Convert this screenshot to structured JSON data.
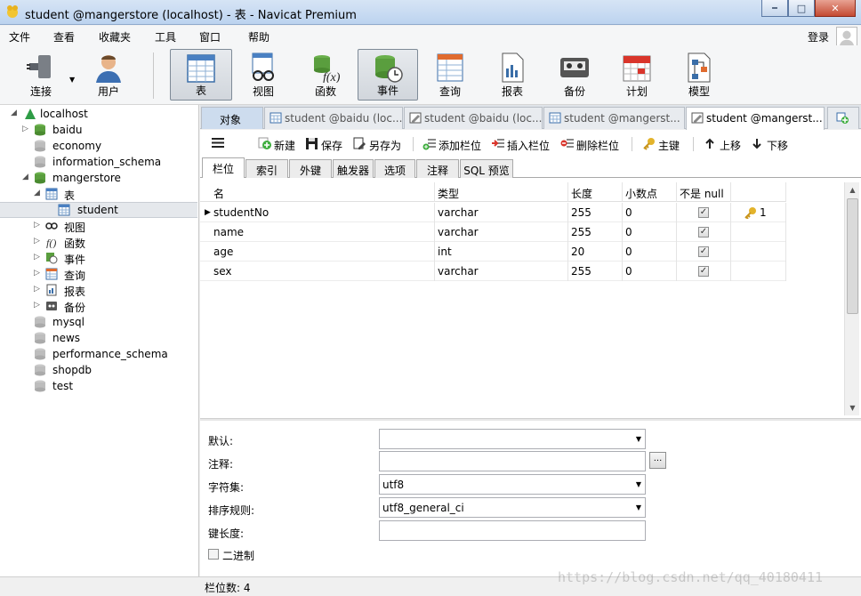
{
  "window": {
    "title": "student @mangerstore (localhost) - 表 - Navicat Premium"
  },
  "menu": {
    "items": [
      "文件",
      "查看",
      "收藏夹",
      "工具",
      "窗口",
      "帮助"
    ],
    "login": "登录"
  },
  "toolbar": {
    "buttons": [
      "连接",
      "用户",
      "表",
      "视图",
      "函数",
      "事件",
      "查询",
      "报表",
      "备份",
      "计划",
      "模型"
    ],
    "active": "表"
  },
  "tree": {
    "connection": "localhost",
    "databases_top": [
      "baidu",
      "economy",
      "information_schema"
    ],
    "open_db": "mangerstore",
    "tables_folder": "表",
    "selected_table": "student",
    "folders": [
      "视图",
      "函数",
      "事件",
      "查询",
      "报表",
      "备份"
    ],
    "databases_bottom": [
      "mysql",
      "news",
      "performance_schema",
      "shopdb",
      "test"
    ]
  },
  "tabs": {
    "objects": "对象",
    "doc_tabs": [
      "student @baidu (loc...",
      "student @baidu (loc...",
      "student @mangerst...",
      "student @mangerst..."
    ]
  },
  "design_toolbar": {
    "buttons": [
      "新建",
      "保存",
      "另存为",
      "添加栏位",
      "插入栏位",
      "删除栏位",
      "主键",
      "上移",
      "下移"
    ]
  },
  "sub_tabs": {
    "items": [
      "栏位",
      "索引",
      "外键",
      "触发器",
      "选项",
      "注释",
      "SQL 预览"
    ],
    "active": "栏位"
  },
  "fields_grid": {
    "columns": [
      "名",
      "类型",
      "长度",
      "小数点",
      "不是 null",
      ""
    ],
    "rows": [
      {
        "name": "studentNo",
        "type": "varchar",
        "length": "255",
        "decimals": "0",
        "not_null": true,
        "key": "1"
      },
      {
        "name": "name",
        "type": "varchar",
        "length": "255",
        "decimals": "0",
        "not_null": true,
        "key": ""
      },
      {
        "name": "age",
        "type": "int",
        "length": "20",
        "decimals": "0",
        "not_null": true,
        "key": ""
      },
      {
        "name": "sex",
        "type": "varchar",
        "length": "255",
        "decimals": "0",
        "not_null": true,
        "key": ""
      }
    ]
  },
  "properties": {
    "default_label": "默认:",
    "default_value": "",
    "comment_label": "注释:",
    "comment_value": "",
    "comment_btn": "...",
    "charset_label": "字符集:",
    "charset_value": "utf8",
    "collation_label": "排序规则:",
    "collation_value": "utf8_general_ci",
    "keylen_label": "键长度:",
    "keylen_value": "",
    "binary_label": "二进制"
  },
  "status": {
    "text": "栏位数: 4"
  },
  "watermark": "https://blog.csdn.net/qq_40180411",
  "colors": {
    "titlebar": "#c8daf1",
    "selection": "#e5e8ec",
    "objects_tab": "#cddcee",
    "key_gold": "#e3b32b"
  }
}
